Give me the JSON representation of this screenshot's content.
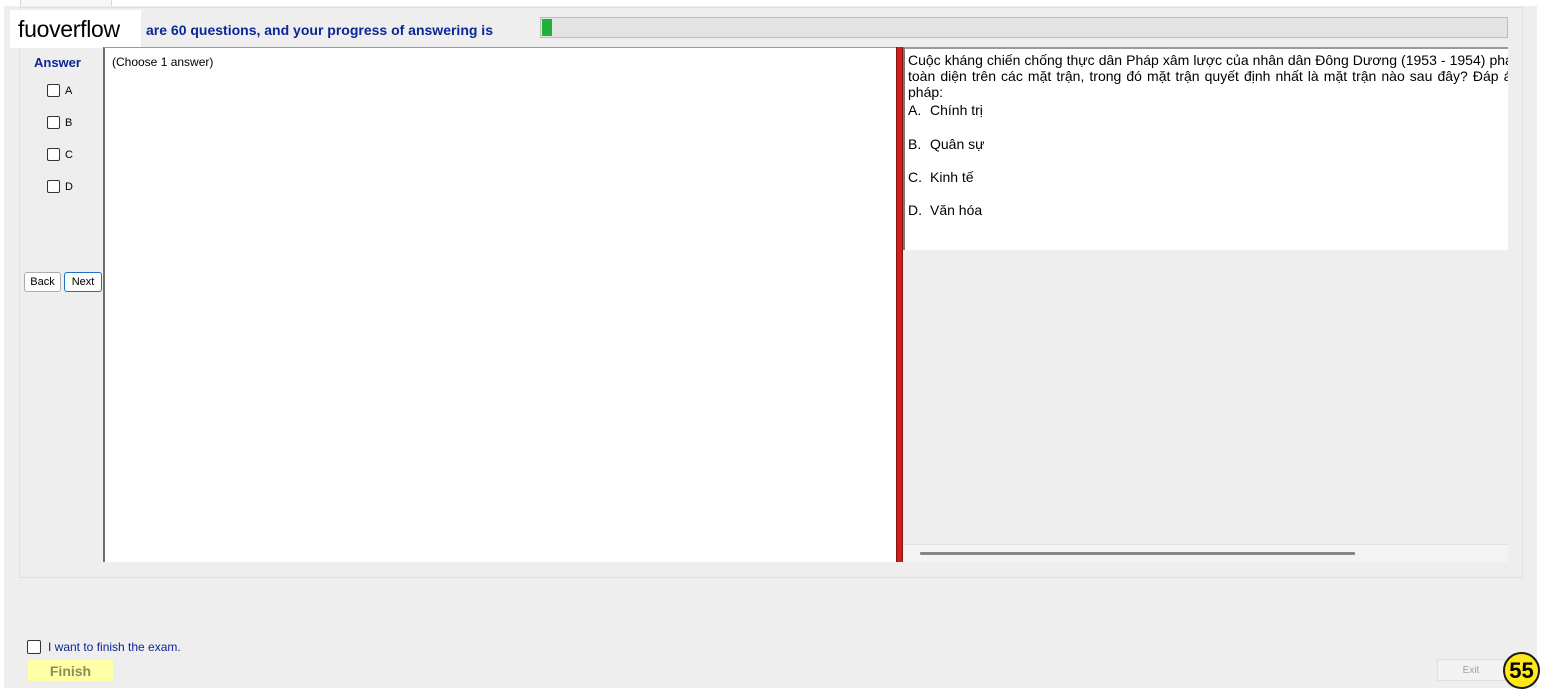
{
  "header": {
    "logo": "fuoverflow",
    "progress_text": "are 60 questions, and your progress of answering is",
    "progress_fraction": 0.01
  },
  "answer": {
    "heading": "Answer",
    "options": [
      "A",
      "B",
      "C",
      "D"
    ]
  },
  "nav": {
    "back_label": "Back",
    "next_label": "Next"
  },
  "left_panel": {
    "instruction": "(Choose 1 answer)"
  },
  "question": {
    "text": "Cuộc kháng chiến chống thực dân Pháp xâm lược của nhân dân Đông Dương (1953 - 1954) phát triển toàn diện trên các mặt trận, trong đó mặt trận quyết định nhất là mặt trận nào sau đây? Đáp án/Giải pháp:",
    "options": [
      {
        "letter": "A.",
        "text": "Chính trị"
      },
      {
        "letter": "B.",
        "text": "Quân sự"
      },
      {
        "letter": "C.",
        "text": "Kinh tế"
      },
      {
        "letter": "D.",
        "text": "Văn hóa"
      }
    ]
  },
  "footer": {
    "finish_checkbox_label": "I want to finish the exam.",
    "finish_label": "Finish",
    "exit_label": "Exit",
    "badge": "55"
  },
  "colors": {
    "accent_text": "#0b2696",
    "progress_fill": "#1fb13a",
    "splitter": "#d31c1c",
    "finish_bg": "#ffffa6",
    "badge_bg": "#ffe81a"
  }
}
